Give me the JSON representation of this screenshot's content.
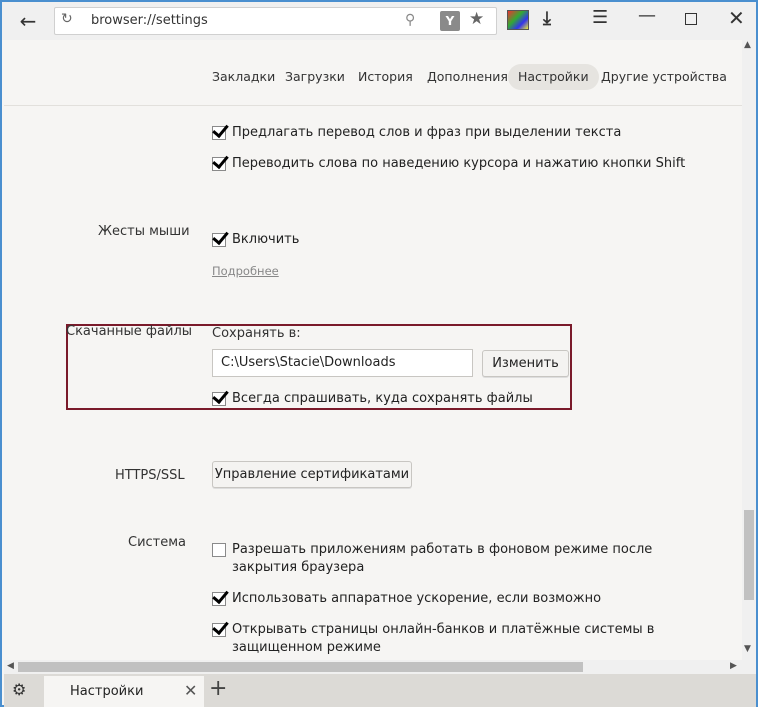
{
  "toolbar": {
    "address": "browser://settings"
  },
  "nav": {
    "tabs": [
      "Закладки",
      "Загрузки",
      "История",
      "Дополнения",
      "Настройки",
      "Другие устройства"
    ],
    "active": "Настройки"
  },
  "translation": {
    "options": [
      {
        "label": "Предлагать перевод слов и фраз при выделении текста",
        "checked": true
      },
      {
        "label": "Переводить слова по наведению курсора и нажатию кнопки Shift",
        "checked": true
      }
    ]
  },
  "gestures": {
    "label": "Жесты мыши",
    "enable_label": "Включить",
    "enable_checked": true,
    "more_link": "Подробнее"
  },
  "downloads": {
    "label": "Скачанные файлы",
    "save_to_label": "Сохранять в:",
    "path": "C:\\Users\\Stacie\\Downloads",
    "change_button": "Изменить",
    "always_ask_label": "Всегда спрашивать, куда сохранять файлы",
    "always_ask_checked": true
  },
  "https": {
    "label": "HTTPS/SSL",
    "manage_button": "Управление сертификатами"
  },
  "system": {
    "label": "Система",
    "options": [
      {
        "label": "Разрешать приложениям работать в фоновом режиме после закрытия браузера",
        "checked": false
      },
      {
        "label": "Использовать аппаратное ускорение, если возможно",
        "checked": true
      },
      {
        "label": "Открывать страницы онлайн-банков и платёжные системы в защищенном режиме",
        "checked": true
      }
    ]
  },
  "tabbar": {
    "tab_label": "Настройки"
  },
  "colors": {
    "highlight_border": "#7a1a2a",
    "window_border": "#4a8fcf"
  }
}
